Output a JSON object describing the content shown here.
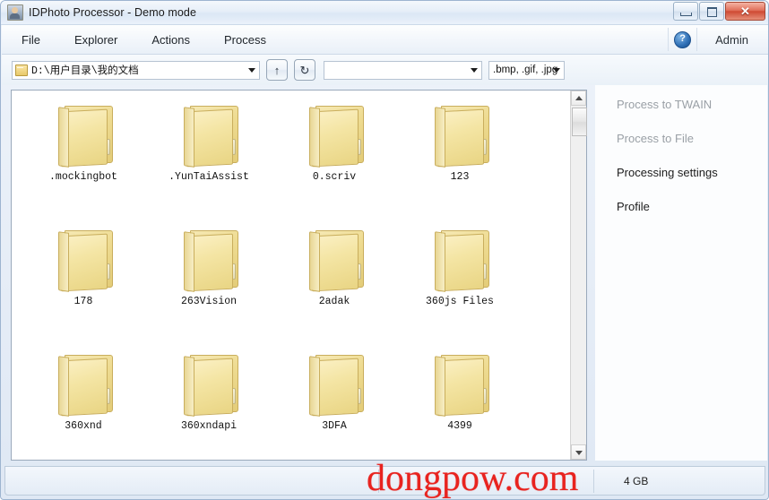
{
  "window": {
    "title": "IDPhoto Processor - Demo mode",
    "app_icon": "id-photo-icon",
    "controls": {
      "minimize": "minimize-icon",
      "maximize": "maximize-icon",
      "close": "✕"
    }
  },
  "menu": {
    "items": [
      {
        "label": "File"
      },
      {
        "label": "Explorer"
      },
      {
        "label": "Actions"
      },
      {
        "label": "Process"
      }
    ],
    "help_icon": "?",
    "user_label": "Admin"
  },
  "toolbar": {
    "path_value": "D:\\用户目录\\我的文档",
    "path_icon": "folder-icon",
    "up_button": "↑",
    "refresh_button": "↻",
    "second_combo_value": "",
    "filter_value": ".bmp, .gif, .jpg"
  },
  "browser": {
    "items": [
      {
        "name": ".mockingbot",
        "type": "folder"
      },
      {
        "name": ".YunTaiAssist",
        "type": "folder"
      },
      {
        "name": "0.scriv",
        "type": "folder"
      },
      {
        "name": "123",
        "type": "folder"
      },
      {
        "name": "178",
        "type": "folder"
      },
      {
        "name": "263Vision",
        "type": "folder"
      },
      {
        "name": "2adak",
        "type": "folder"
      },
      {
        "name": "360js Files",
        "type": "folder"
      },
      {
        "name": "360xnd",
        "type": "folder"
      },
      {
        "name": "360xndapi",
        "type": "folder"
      },
      {
        "name": "3DFA",
        "type": "folder"
      },
      {
        "name": "4399",
        "type": "folder"
      }
    ],
    "scrollbar": {
      "up_arrow": "▲",
      "down_arrow": "▼"
    }
  },
  "right_panel": {
    "items": [
      {
        "label": "Process to TWAIN",
        "enabled": false
      },
      {
        "label": "Process to File",
        "enabled": false
      },
      {
        "label": "Processing settings",
        "enabled": true
      },
      {
        "label": "Profile",
        "enabled": true
      }
    ]
  },
  "statusbar": {
    "left_text": "",
    "middle_text": "",
    "right_text": "4 GB"
  },
  "watermark": {
    "text": "dongpow",
    "separator": ".",
    "suffix": "com",
    "color": "#e8231f"
  }
}
